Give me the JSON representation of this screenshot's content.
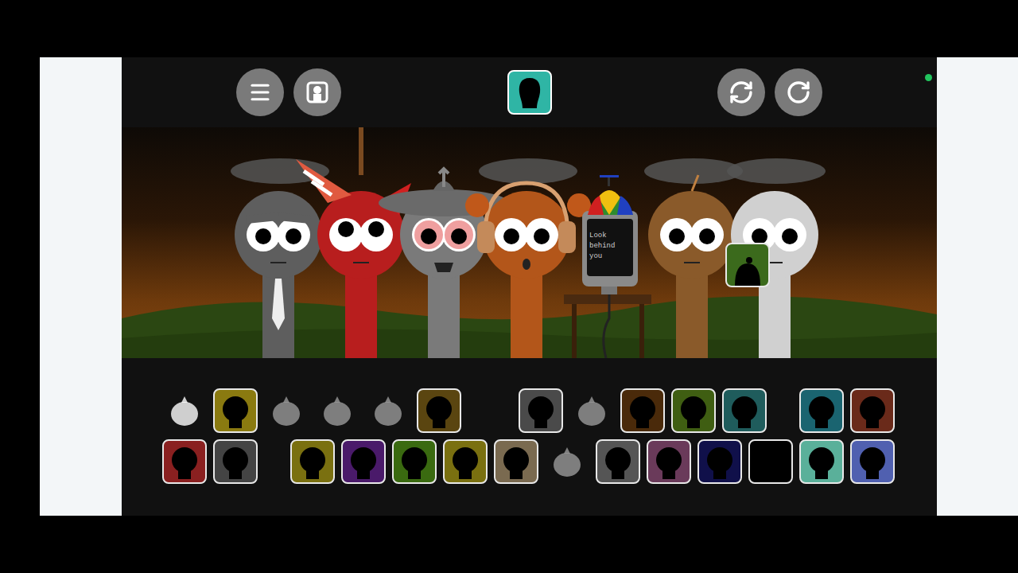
{
  "top_bar": {
    "buttons": [
      {
        "name": "menu",
        "selected": false
      },
      {
        "name": "gallery",
        "selected": false
      },
      {
        "name": "character-view",
        "selected": true
      },
      {
        "name": "reset",
        "selected": false
      },
      {
        "name": "record",
        "selected": false
      }
    ],
    "status_dot": {
      "color": "#22c55e"
    }
  },
  "stage": {
    "characters": [
      {
        "kind": "tie",
        "color": "#5e5e5e"
      },
      {
        "kind": "cone",
        "color": "#b81e1e"
      },
      {
        "kind": "saucer",
        "color": "#7a7a7a"
      },
      {
        "kind": "headphones",
        "color": "#b3561a"
      },
      {
        "kind": "computer",
        "color": "#8a8a8a",
        "screen_text": "Look behind you"
      },
      {
        "kind": "antenna",
        "color": "#8a5a2a"
      },
      {
        "kind": "plain",
        "color": "#d0d0d0"
      }
    ],
    "dragging": {
      "color": "#3b6a1c"
    }
  },
  "slots": [
    [
      {
        "kind": "used",
        "color": "#ffffff"
      },
      {
        "kind": "box",
        "color": "#8a7a10"
      },
      {
        "kind": "used",
        "color": "#9a9a9a"
      },
      {
        "kind": "used",
        "color": "#9a9a9a"
      },
      {
        "kind": "used",
        "color": "#9a9a9a"
      },
      {
        "kind": "box",
        "color": "#5a4510"
      },
      {
        "kind": "space",
        "color": "#000000"
      },
      {
        "kind": "box",
        "color": "#4a4a4a"
      },
      {
        "kind": "used",
        "color": "#9a9a9a"
      },
      {
        "kind": "box",
        "color": "#4a2a0a"
      },
      {
        "kind": "box",
        "color": "#3f5e12"
      },
      {
        "kind": "box",
        "color": "#1f5c5c"
      },
      {
        "kind": "half-space",
        "color": "#000000"
      },
      {
        "kind": "box",
        "color": "#1a6470"
      },
      {
        "kind": "box",
        "color": "#6a2a1a"
      }
    ],
    [
      {
        "kind": "box",
        "color": "#8a2020"
      },
      {
        "kind": "box",
        "color": "#444444"
      },
      {
        "kind": "half-space",
        "color": "#000000"
      },
      {
        "kind": "box",
        "color": "#7a7010"
      },
      {
        "kind": "box",
        "color": "#4a1a6a"
      },
      {
        "kind": "box",
        "color": "#3a6a10"
      },
      {
        "kind": "box",
        "color": "#7a7010"
      },
      {
        "kind": "box",
        "color": "#7a6a50"
      },
      {
        "kind": "used",
        "color": "#9a9a9a"
      },
      {
        "kind": "box",
        "color": "#555555"
      },
      {
        "kind": "box",
        "color": "#6a3a5a"
      },
      {
        "kind": "box",
        "color": "#10104a"
      },
      {
        "kind": "box",
        "color": "#000000"
      },
      {
        "kind": "box",
        "color": "#5ab09a"
      },
      {
        "kind": "box",
        "color": "#5060b0"
      }
    ]
  ]
}
